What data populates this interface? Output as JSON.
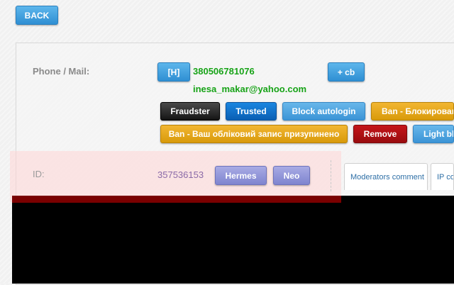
{
  "header": {
    "back_label": "BACK"
  },
  "contact": {
    "label": "Phone / Mail:",
    "h_button": "[H]",
    "phone": "380506781076",
    "email": "inesa_makar@yahoo.com",
    "cb_button": "+ cb"
  },
  "actions": {
    "row1": [
      "Fraudster",
      "Trusted",
      "Block autologin",
      "Ban - Блокирован"
    ],
    "row2": [
      "Ban - Ваш обліковий запис призупинено",
      "Remove",
      "Light bl"
    ]
  },
  "id_row": {
    "label": "ID:",
    "value": "357536153",
    "buttons": [
      "Hermes",
      "Neo"
    ]
  },
  "tabs": [
    "Moderators comment",
    "IP co"
  ],
  "colors": {
    "accent_blue": "#2f8fd3",
    "green_text": "#17a317",
    "remove_red": "#c5161a",
    "ban_yellow": "#d89a0a",
    "violet_button": "#7f84cf"
  }
}
